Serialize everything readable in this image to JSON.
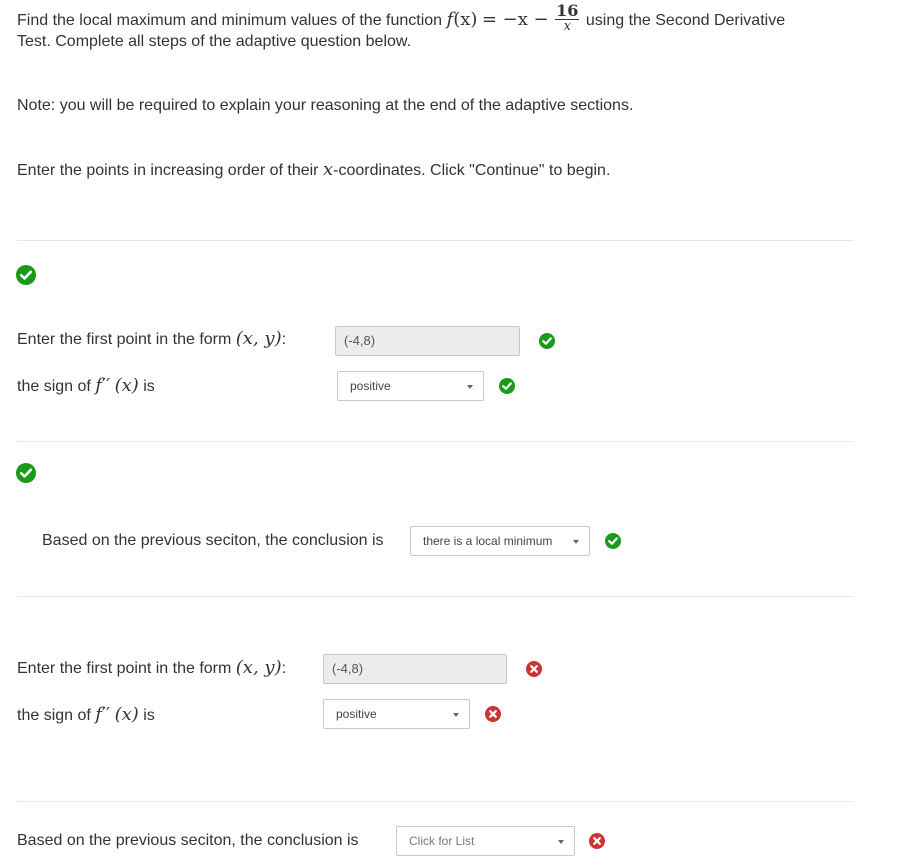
{
  "intro": {
    "line1_prefix": "Find the local maximum and minimum values of the function",
    "func_f": "f",
    "func_x": "(x)",
    "func_eq": "= −x −",
    "frac_num": "16",
    "frac_den": "x",
    "line1_suffix": "using the Second Derivative",
    "line2": "Test. Complete all steps of the adaptive question below."
  },
  "note": "Note: you will be required to explain your reasoning at the end of the adaptive sections.",
  "instruction": {
    "prefix": "Enter the points in increasing order of their",
    "x": "x",
    "suffix": "-coordinates. Click \"Continue\" to begin."
  },
  "section1": {
    "point_label": "Enter the first point in the form",
    "point_math": "(x, y)",
    "point_colon": ":",
    "point_value": "(-4,8)",
    "sign_label_prefix": "the sign of",
    "sign_f": "f",
    "sign_primes": "′′",
    "sign_x": "(x)",
    "sign_label_suffix": "is",
    "sign_value": "positive"
  },
  "section2": {
    "conclusion_label": "Based on the previous seciton, the conclusion is",
    "conclusion_value": "there is a local minimum"
  },
  "section3": {
    "point_label": "Enter the first point in the form",
    "point_math": "(x, y)",
    "point_colon": ":",
    "point_value": "(-4,8)",
    "sign_label_prefix": "the sign of",
    "sign_f": "f",
    "sign_primes": "′′",
    "sign_x": "(x)",
    "sign_label_suffix": "is",
    "sign_value": "positive"
  },
  "section4": {
    "conclusion_label": "Based on the previous seciton, the conclusion is",
    "conclusion_placeholder": "Click for List"
  },
  "colors": {
    "correct": "#1a9a1a",
    "incorrect": "#cc3333",
    "text": "#333333",
    "divider": "#e8e8e8"
  },
  "icons": {
    "correct": "check-circle-icon",
    "incorrect": "x-circle-icon",
    "dropdown": "caret-down-icon"
  }
}
